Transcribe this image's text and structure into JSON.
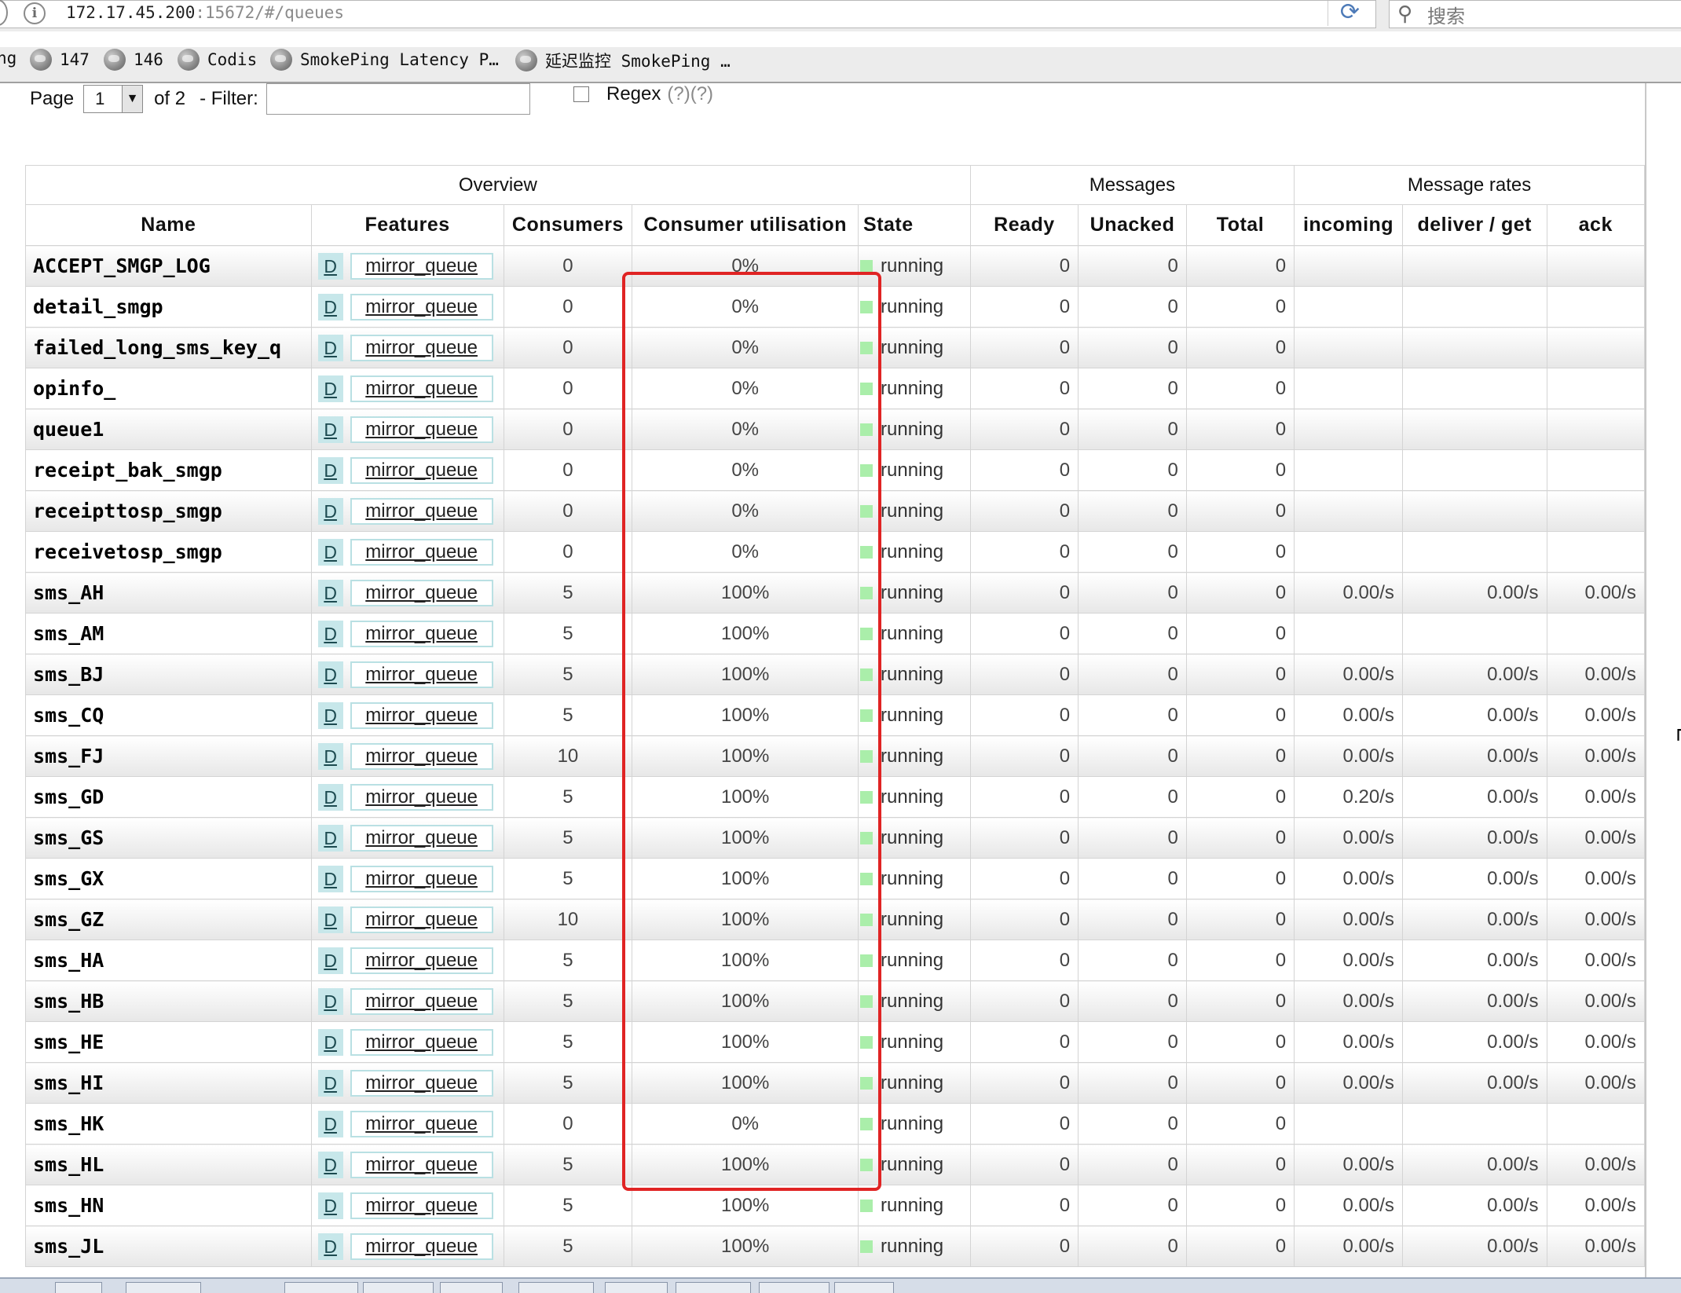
{
  "browser": {
    "url_host": "172.17.45.200",
    "url_rest": ":15672/#/queues",
    "search_placeholder": "搜索",
    "reload_glyph": "⟳",
    "bookmarks": [
      {
        "label": "ng",
        "icon": "none"
      },
      {
        "label": "147",
        "icon": "globe-icon"
      },
      {
        "label": "146",
        "icon": "globe-icon"
      },
      {
        "label": "Codis",
        "icon": "globe-icon"
      },
      {
        "label": "SmokePing Latency P…",
        "icon": "globe-icon"
      },
      {
        "label": "延迟监控 SmokePing …",
        "icon": "globe-icon"
      }
    ]
  },
  "pager": {
    "page_label": "Page",
    "page_value": "1",
    "of_label": "of 2",
    "filter_label": "- Filter:",
    "filter_value": "",
    "regex_label": "Regex",
    "regex_help": "(?)(?)"
  },
  "table": {
    "group_headers": {
      "overview": "Overview",
      "messages": "Messages",
      "message_rates": "Message rates"
    },
    "columns": {
      "name": "Name",
      "features": "Features",
      "consumers": "Consumers",
      "utilisation": "Consumer utilisation",
      "state": "State",
      "ready": "Ready",
      "unacked": "Unacked",
      "total": "Total",
      "incoming": "incoming",
      "deliver_get": "deliver / get",
      "ack": "ack"
    },
    "feature_d": "D",
    "feature_policy": "mirror_queue",
    "state_color": "#aaeeaa",
    "rows": [
      {
        "name": "ACCEPT_SMGP_LOG",
        "consumers": "0",
        "util": "0%",
        "state": "running",
        "ready": "0",
        "unacked": "0",
        "total": "0",
        "incoming": "",
        "deliver": "",
        "ack": ""
      },
      {
        "name": "detail_smgp",
        "consumers": "0",
        "util": "0%",
        "state": "running",
        "ready": "0",
        "unacked": "0",
        "total": "0",
        "incoming": "",
        "deliver": "",
        "ack": ""
      },
      {
        "name": "failed_long_sms_key_q",
        "consumers": "0",
        "util": "0%",
        "state": "running",
        "ready": "0",
        "unacked": "0",
        "total": "0",
        "incoming": "",
        "deliver": "",
        "ack": ""
      },
      {
        "name": "opinfo_",
        "consumers": "0",
        "util": "0%",
        "state": "running",
        "ready": "0",
        "unacked": "0",
        "total": "0",
        "incoming": "",
        "deliver": "",
        "ack": ""
      },
      {
        "name": "queue1",
        "consumers": "0",
        "util": "0%",
        "state": "running",
        "ready": "0",
        "unacked": "0",
        "total": "0",
        "incoming": "",
        "deliver": "",
        "ack": ""
      },
      {
        "name": "receipt_bak_smgp",
        "consumers": "0",
        "util": "0%",
        "state": "running",
        "ready": "0",
        "unacked": "0",
        "total": "0",
        "incoming": "",
        "deliver": "",
        "ack": ""
      },
      {
        "name": "receipttosp_smgp",
        "consumers": "0",
        "util": "0%",
        "state": "running",
        "ready": "0",
        "unacked": "0",
        "total": "0",
        "incoming": "",
        "deliver": "",
        "ack": ""
      },
      {
        "name": "receivetosp_smgp",
        "consumers": "0",
        "util": "0%",
        "state": "running",
        "ready": "0",
        "unacked": "0",
        "total": "0",
        "incoming": "",
        "deliver": "",
        "ack": ""
      },
      {
        "name": "sms_AH",
        "consumers": "5",
        "util": "100%",
        "state": "running",
        "ready": "0",
        "unacked": "0",
        "total": "0",
        "incoming": "0.00/s",
        "deliver": "0.00/s",
        "ack": "0.00/s"
      },
      {
        "name": "sms_AM",
        "consumers": "5",
        "util": "100%",
        "state": "running",
        "ready": "0",
        "unacked": "0",
        "total": "0",
        "incoming": "",
        "deliver": "",
        "ack": ""
      },
      {
        "name": "sms_BJ",
        "consumers": "5",
        "util": "100%",
        "state": "running",
        "ready": "0",
        "unacked": "0",
        "total": "0",
        "incoming": "0.00/s",
        "deliver": "0.00/s",
        "ack": "0.00/s"
      },
      {
        "name": "sms_CQ",
        "consumers": "5",
        "util": "100%",
        "state": "running",
        "ready": "0",
        "unacked": "0",
        "total": "0",
        "incoming": "0.00/s",
        "deliver": "0.00/s",
        "ack": "0.00/s"
      },
      {
        "name": "sms_FJ",
        "consumers": "10",
        "util": "100%",
        "state": "running",
        "ready": "0",
        "unacked": "0",
        "total": "0",
        "incoming": "0.00/s",
        "deliver": "0.00/s",
        "ack": "0.00/s"
      },
      {
        "name": "sms_GD",
        "consumers": "5",
        "util": "100%",
        "state": "running",
        "ready": "0",
        "unacked": "0",
        "total": "0",
        "incoming": "0.20/s",
        "deliver": "0.00/s",
        "ack": "0.00/s"
      },
      {
        "name": "sms_GS",
        "consumers": "5",
        "util": "100%",
        "state": "running",
        "ready": "0",
        "unacked": "0",
        "total": "0",
        "incoming": "0.00/s",
        "deliver": "0.00/s",
        "ack": "0.00/s"
      },
      {
        "name": "sms_GX",
        "consumers": "5",
        "util": "100%",
        "state": "running",
        "ready": "0",
        "unacked": "0",
        "total": "0",
        "incoming": "0.00/s",
        "deliver": "0.00/s",
        "ack": "0.00/s"
      },
      {
        "name": "sms_GZ",
        "consumers": "10",
        "util": "100%",
        "state": "running",
        "ready": "0",
        "unacked": "0",
        "total": "0",
        "incoming": "0.00/s",
        "deliver": "0.00/s",
        "ack": "0.00/s"
      },
      {
        "name": "sms_HA",
        "consumers": "5",
        "util": "100%",
        "state": "running",
        "ready": "0",
        "unacked": "0",
        "total": "0",
        "incoming": "0.00/s",
        "deliver": "0.00/s",
        "ack": "0.00/s"
      },
      {
        "name": "sms_HB",
        "consumers": "5",
        "util": "100%",
        "state": "running",
        "ready": "0",
        "unacked": "0",
        "total": "0",
        "incoming": "0.00/s",
        "deliver": "0.00/s",
        "ack": "0.00/s"
      },
      {
        "name": "sms_HE",
        "consumers": "5",
        "util": "100%",
        "state": "running",
        "ready": "0",
        "unacked": "0",
        "total": "0",
        "incoming": "0.00/s",
        "deliver": "0.00/s",
        "ack": "0.00/s"
      },
      {
        "name": "sms_HI",
        "consumers": "5",
        "util": "100%",
        "state": "running",
        "ready": "0",
        "unacked": "0",
        "total": "0",
        "incoming": "0.00/s",
        "deliver": "0.00/s",
        "ack": "0.00/s"
      },
      {
        "name": "sms_HK",
        "consumers": "0",
        "util": "0%",
        "state": "running",
        "ready": "0",
        "unacked": "0",
        "total": "0",
        "incoming": "",
        "deliver": "",
        "ack": ""
      },
      {
        "name": "sms_HL",
        "consumers": "5",
        "util": "100%",
        "state": "running",
        "ready": "0",
        "unacked": "0",
        "total": "0",
        "incoming": "0.00/s",
        "deliver": "0.00/s",
        "ack": "0.00/s"
      },
      {
        "name": "sms_HN",
        "consumers": "5",
        "util": "100%",
        "state": "running",
        "ready": "0",
        "unacked": "0",
        "total": "0",
        "incoming": "0.00/s",
        "deliver": "0.00/s",
        "ack": "0.00/s"
      },
      {
        "name": "sms_JL",
        "consumers": "5",
        "util": "100%",
        "state": "running",
        "ready": "0",
        "unacked": "0",
        "total": "0",
        "incoming": "0.00/s",
        "deliver": "0.00/s",
        "ack": "0.00/s"
      }
    ]
  },
  "highlight_color": "#e02424"
}
